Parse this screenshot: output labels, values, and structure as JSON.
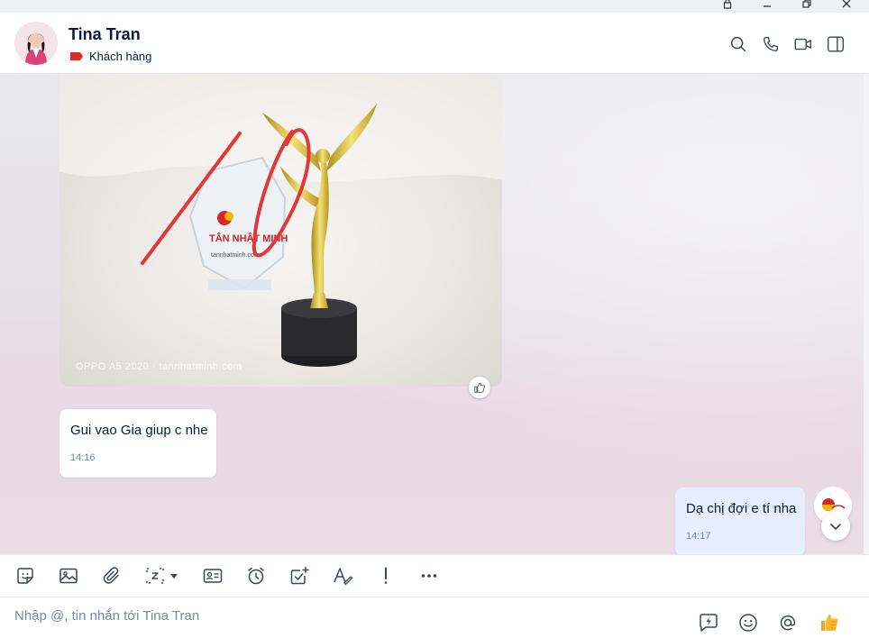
{
  "header": {
    "contact_name": "Tina Tran",
    "tag_label": "Khách hàng",
    "tag_color": "#e02b2b"
  },
  "messages": [
    {
      "type": "image",
      "direction": "incoming",
      "caption": "OPPO A5 2020 · tannhatminh.com",
      "annotation_text": "10"
    },
    {
      "type": "text",
      "direction": "incoming",
      "text": "Gui vao Gia giup c nhe",
      "time": "14:16"
    },
    {
      "type": "text",
      "direction": "outgoing",
      "text": "Dạ chị đợi e tí nha",
      "time": "14:17"
    }
  ],
  "toolbar": {
    "icons": [
      "sticker-icon",
      "image-icon",
      "attachment-icon",
      "screenshot-icon",
      "contact-card-icon",
      "reminder-icon",
      "todo-icon",
      "format-text-icon",
      "urgent-icon",
      "more-icon"
    ]
  },
  "input": {
    "placeholder": "Nhập @, tin nhắn tới Tina Tran"
  },
  "colors": {
    "accent": "#0068ff",
    "outgoing_bubble": "#e5efff",
    "incoming_bubble": "#ffffff",
    "text_primary": "#081c36",
    "text_secondary": "#7589a3"
  }
}
